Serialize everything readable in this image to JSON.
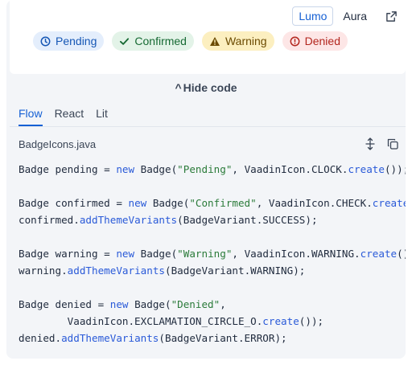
{
  "theme_switcher": {
    "options": [
      "Lumo",
      "Aura"
    ],
    "active": "Lumo"
  },
  "badges": [
    {
      "label": "Pending",
      "icon": "clock-icon",
      "variant": "pending"
    },
    {
      "label": "Confirmed",
      "icon": "check-icon",
      "variant": "success"
    },
    {
      "label": "Warning",
      "icon": "warning-icon",
      "variant": "warning"
    },
    {
      "label": "Denied",
      "icon": "exclamation-circle-icon",
      "variant": "error"
    }
  ],
  "toggle_code_label": "Hide code",
  "tabs": [
    "Flow",
    "React",
    "Lit"
  ],
  "active_tab": "Flow",
  "file_name": "BadgeIcons.java",
  "code_lines": [
    [
      [
        "Badge pending = ",
        ""
      ],
      [
        "new",
        "kw"
      ],
      [
        " Badge(",
        ""
      ],
      [
        "\"Pending\"",
        "str"
      ],
      [
        ", VaadinIcon.CLOCK.",
        ""
      ],
      [
        "create",
        "fn"
      ],
      [
        "());",
        ""
      ]
    ],
    [],
    [
      [
        "Badge confirmed = ",
        ""
      ],
      [
        "new",
        "kw"
      ],
      [
        " Badge(",
        ""
      ],
      [
        "\"Confirmed\"",
        "str"
      ],
      [
        ", VaadinIcon.CHECK.",
        ""
      ],
      [
        "create",
        "fn"
      ],
      [
        "());",
        ""
      ]
    ],
    [
      [
        "confirmed.",
        ""
      ],
      [
        "addThemeVariants",
        "fn"
      ],
      [
        "(BadgeVariant.SUCCESS);",
        ""
      ]
    ],
    [],
    [
      [
        "Badge warning = ",
        ""
      ],
      [
        "new",
        "kw"
      ],
      [
        " Badge(",
        ""
      ],
      [
        "\"Warning\"",
        "str"
      ],
      [
        ", VaadinIcon.WARNING.",
        ""
      ],
      [
        "create",
        "fn"
      ],
      [
        "());",
        ""
      ]
    ],
    [
      [
        "warning.",
        ""
      ],
      [
        "addThemeVariants",
        "fn"
      ],
      [
        "(BadgeVariant.WARNING);",
        ""
      ]
    ],
    [],
    [
      [
        "Badge denied = ",
        ""
      ],
      [
        "new",
        "kw"
      ],
      [
        " Badge(",
        ""
      ],
      [
        "\"Denied\"",
        "str"
      ],
      [
        ",",
        ""
      ]
    ],
    [
      [
        "        VaadinIcon.EXCLAMATION_CIRCLE_O.",
        ""
      ],
      [
        "create",
        "fn"
      ],
      [
        "());",
        ""
      ]
    ],
    [
      [
        "denied.",
        ""
      ],
      [
        "addThemeVariants",
        "fn"
      ],
      [
        "(BadgeVariant.ERROR);",
        ""
      ]
    ]
  ],
  "colors": {
    "accent": "#1560d4",
    "background": "#f3f5f8"
  }
}
